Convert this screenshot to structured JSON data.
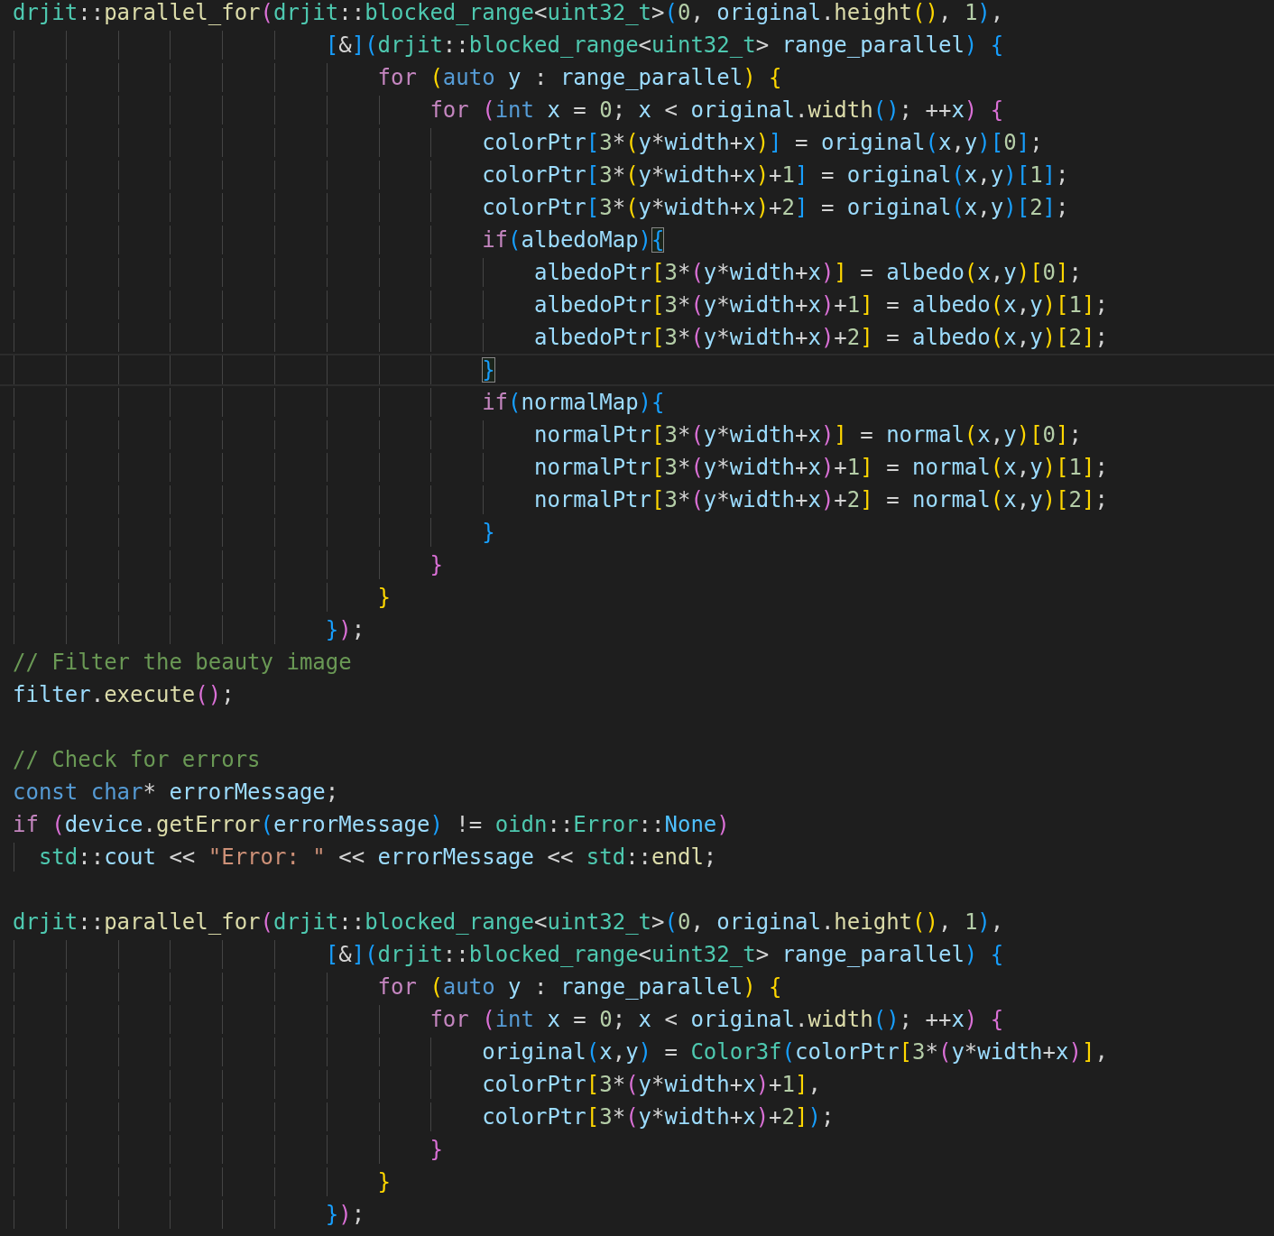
{
  "editor": {
    "lines": [
      {
        "current": false,
        "tokens": [
          {
            "kind": "ns",
            "text": "drjit"
          },
          {
            "kind": "op",
            "text": "::"
          },
          {
            "kind": "fn",
            "text": "parallel_for"
          },
          {
            "kind": "open",
            "text": "("
          },
          {
            "kind": "ns",
            "text": "drjit"
          },
          {
            "kind": "op",
            "text": "::"
          },
          {
            "kind": "ty",
            "text": "blocked_range"
          },
          {
            "kind": "op",
            "text": "<"
          },
          {
            "kind": "ty",
            "text": "uint32_t"
          },
          {
            "kind": "op",
            "text": ">"
          },
          {
            "kind": "open",
            "text": "("
          },
          {
            "kind": "num",
            "text": "0"
          },
          {
            "kind": "op",
            "text": ", "
          },
          {
            "kind": "var",
            "text": "original"
          },
          {
            "kind": "op",
            "text": "."
          },
          {
            "kind": "fn",
            "text": "height"
          },
          {
            "kind": "open",
            "text": "("
          },
          {
            "kind": "close",
            "text": ")"
          },
          {
            "kind": "op",
            "text": ", "
          },
          {
            "kind": "num",
            "text": "1"
          },
          {
            "kind": "close",
            "text": ")"
          },
          {
            "kind": "op",
            "text": ","
          }
        ]
      },
      {
        "current": false,
        "tokens": [
          {
            "kind": "open",
            "text": "                        ["
          },
          {
            "kind": "op",
            "text": "&"
          },
          {
            "kind": "close",
            "text": "]"
          },
          {
            "kind": "open",
            "text": "("
          },
          {
            "kind": "ns",
            "text": "drjit"
          },
          {
            "kind": "op",
            "text": "::"
          },
          {
            "kind": "ty",
            "text": "blocked_range"
          },
          {
            "kind": "op",
            "text": "<"
          },
          {
            "kind": "ty",
            "text": "uint32_t"
          },
          {
            "kind": "op",
            "text": "> "
          },
          {
            "kind": "var",
            "text": "range_parallel"
          },
          {
            "kind": "close",
            "text": ") "
          },
          {
            "kind": "open",
            "text": "{"
          }
        ]
      },
      {
        "current": false,
        "tokens": [
          {
            "kind": "ctl",
            "text": "                            for "
          },
          {
            "kind": "open",
            "text": "("
          },
          {
            "kind": "kw",
            "text": "auto "
          },
          {
            "kind": "var",
            "text": "y"
          },
          {
            "kind": "op",
            "text": " : "
          },
          {
            "kind": "var",
            "text": "range_parallel"
          },
          {
            "kind": "close",
            "text": ") "
          },
          {
            "kind": "open",
            "text": "{"
          }
        ]
      },
      {
        "current": false,
        "tokens": [
          {
            "kind": "ctl",
            "text": "                                for "
          },
          {
            "kind": "open",
            "text": "("
          },
          {
            "kind": "kw",
            "text": "int "
          },
          {
            "kind": "var",
            "text": "x"
          },
          {
            "kind": "op",
            "text": " = "
          },
          {
            "kind": "num",
            "text": "0"
          },
          {
            "kind": "op",
            "text": "; "
          },
          {
            "kind": "var",
            "text": "x"
          },
          {
            "kind": "op",
            "text": " < "
          },
          {
            "kind": "var",
            "text": "original"
          },
          {
            "kind": "op",
            "text": "."
          },
          {
            "kind": "fn",
            "text": "width"
          },
          {
            "kind": "open",
            "text": "("
          },
          {
            "kind": "close",
            "text": ")"
          },
          {
            "kind": "op",
            "text": "; ++"
          },
          {
            "kind": "var",
            "text": "x"
          },
          {
            "kind": "close",
            "text": ") "
          },
          {
            "kind": "open",
            "text": "{"
          }
        ]
      },
      {
        "current": false,
        "tokens": [
          {
            "kind": "var",
            "text": "                                    colorPtr"
          },
          {
            "kind": "open",
            "text": "["
          },
          {
            "kind": "num",
            "text": "3"
          },
          {
            "kind": "op",
            "text": "*"
          },
          {
            "kind": "open",
            "text": "("
          },
          {
            "kind": "var",
            "text": "y"
          },
          {
            "kind": "op",
            "text": "*"
          },
          {
            "kind": "var",
            "text": "width"
          },
          {
            "kind": "op",
            "text": "+"
          },
          {
            "kind": "var",
            "text": "x"
          },
          {
            "kind": "close",
            "text": ")"
          },
          {
            "kind": "close",
            "text": "]"
          },
          {
            "kind": "op",
            "text": " = "
          },
          {
            "kind": "var",
            "text": "original"
          },
          {
            "kind": "open",
            "text": "("
          },
          {
            "kind": "var",
            "text": "x"
          },
          {
            "kind": "op",
            "text": ","
          },
          {
            "kind": "var",
            "text": "y"
          },
          {
            "kind": "close",
            "text": ")"
          },
          {
            "kind": "open",
            "text": "["
          },
          {
            "kind": "num",
            "text": "0"
          },
          {
            "kind": "close",
            "text": "]"
          },
          {
            "kind": "op",
            "text": ";"
          }
        ]
      },
      {
        "current": false,
        "tokens": [
          {
            "kind": "var",
            "text": "                                    colorPtr"
          },
          {
            "kind": "open",
            "text": "["
          },
          {
            "kind": "num",
            "text": "3"
          },
          {
            "kind": "op",
            "text": "*"
          },
          {
            "kind": "open",
            "text": "("
          },
          {
            "kind": "var",
            "text": "y"
          },
          {
            "kind": "op",
            "text": "*"
          },
          {
            "kind": "var",
            "text": "width"
          },
          {
            "kind": "op",
            "text": "+"
          },
          {
            "kind": "var",
            "text": "x"
          },
          {
            "kind": "close",
            "text": ")"
          },
          {
            "kind": "op",
            "text": "+"
          },
          {
            "kind": "num",
            "text": "1"
          },
          {
            "kind": "close",
            "text": "]"
          },
          {
            "kind": "op",
            "text": " = "
          },
          {
            "kind": "var",
            "text": "original"
          },
          {
            "kind": "open",
            "text": "("
          },
          {
            "kind": "var",
            "text": "x"
          },
          {
            "kind": "op",
            "text": ","
          },
          {
            "kind": "var",
            "text": "y"
          },
          {
            "kind": "close",
            "text": ")"
          },
          {
            "kind": "open",
            "text": "["
          },
          {
            "kind": "num",
            "text": "1"
          },
          {
            "kind": "close",
            "text": "]"
          },
          {
            "kind": "op",
            "text": ";"
          }
        ]
      },
      {
        "current": false,
        "tokens": [
          {
            "kind": "var",
            "text": "                                    colorPtr"
          },
          {
            "kind": "open",
            "text": "["
          },
          {
            "kind": "num",
            "text": "3"
          },
          {
            "kind": "op",
            "text": "*"
          },
          {
            "kind": "open",
            "text": "("
          },
          {
            "kind": "var",
            "text": "y"
          },
          {
            "kind": "op",
            "text": "*"
          },
          {
            "kind": "var",
            "text": "width"
          },
          {
            "kind": "op",
            "text": "+"
          },
          {
            "kind": "var",
            "text": "x"
          },
          {
            "kind": "close",
            "text": ")"
          },
          {
            "kind": "op",
            "text": "+"
          },
          {
            "kind": "num",
            "text": "2"
          },
          {
            "kind": "close",
            "text": "]"
          },
          {
            "kind": "op",
            "text": " = "
          },
          {
            "kind": "var",
            "text": "original"
          },
          {
            "kind": "open",
            "text": "("
          },
          {
            "kind": "var",
            "text": "x"
          },
          {
            "kind": "op",
            "text": ","
          },
          {
            "kind": "var",
            "text": "y"
          },
          {
            "kind": "close",
            "text": ")"
          },
          {
            "kind": "open",
            "text": "["
          },
          {
            "kind": "num",
            "text": "2"
          },
          {
            "kind": "close",
            "text": "]"
          },
          {
            "kind": "op",
            "text": ";"
          }
        ]
      },
      {
        "current": false,
        "tokens": [
          {
            "kind": "ctl",
            "text": "                                    if"
          },
          {
            "kind": "open",
            "text": "("
          },
          {
            "kind": "var",
            "text": "albedoMap"
          },
          {
            "kind": "close",
            "text": ")"
          },
          {
            "kind": "open",
            "text": "{",
            "matched": true
          }
        ]
      },
      {
        "current": false,
        "tokens": [
          {
            "kind": "var",
            "text": "                                        albedoPtr"
          },
          {
            "kind": "open",
            "text": "["
          },
          {
            "kind": "num",
            "text": "3"
          },
          {
            "kind": "op",
            "text": "*"
          },
          {
            "kind": "open",
            "text": "("
          },
          {
            "kind": "var",
            "text": "y"
          },
          {
            "kind": "op",
            "text": "*"
          },
          {
            "kind": "var",
            "text": "width"
          },
          {
            "kind": "op",
            "text": "+"
          },
          {
            "kind": "var",
            "text": "x"
          },
          {
            "kind": "close",
            "text": ")"
          },
          {
            "kind": "close",
            "text": "]"
          },
          {
            "kind": "op",
            "text": " = "
          },
          {
            "kind": "var",
            "text": "albedo"
          },
          {
            "kind": "open",
            "text": "("
          },
          {
            "kind": "var",
            "text": "x"
          },
          {
            "kind": "op",
            "text": ","
          },
          {
            "kind": "var",
            "text": "y"
          },
          {
            "kind": "close",
            "text": ")"
          },
          {
            "kind": "open",
            "text": "["
          },
          {
            "kind": "num",
            "text": "0"
          },
          {
            "kind": "close",
            "text": "]"
          },
          {
            "kind": "op",
            "text": ";"
          }
        ]
      },
      {
        "current": false,
        "tokens": [
          {
            "kind": "var",
            "text": "                                        albedoPtr"
          },
          {
            "kind": "open",
            "text": "["
          },
          {
            "kind": "num",
            "text": "3"
          },
          {
            "kind": "op",
            "text": "*"
          },
          {
            "kind": "open",
            "text": "("
          },
          {
            "kind": "var",
            "text": "y"
          },
          {
            "kind": "op",
            "text": "*"
          },
          {
            "kind": "var",
            "text": "width"
          },
          {
            "kind": "op",
            "text": "+"
          },
          {
            "kind": "var",
            "text": "x"
          },
          {
            "kind": "close",
            "text": ")"
          },
          {
            "kind": "op",
            "text": "+"
          },
          {
            "kind": "num",
            "text": "1"
          },
          {
            "kind": "close",
            "text": "]"
          },
          {
            "kind": "op",
            "text": " = "
          },
          {
            "kind": "var",
            "text": "albedo"
          },
          {
            "kind": "open",
            "text": "("
          },
          {
            "kind": "var",
            "text": "x"
          },
          {
            "kind": "op",
            "text": ","
          },
          {
            "kind": "var",
            "text": "y"
          },
          {
            "kind": "close",
            "text": ")"
          },
          {
            "kind": "open",
            "text": "["
          },
          {
            "kind": "num",
            "text": "1"
          },
          {
            "kind": "close",
            "text": "]"
          },
          {
            "kind": "op",
            "text": ";"
          }
        ]
      },
      {
        "current": false,
        "tokens": [
          {
            "kind": "var",
            "text": "                                        albedoPtr"
          },
          {
            "kind": "open",
            "text": "["
          },
          {
            "kind": "num",
            "text": "3"
          },
          {
            "kind": "op",
            "text": "*"
          },
          {
            "kind": "open",
            "text": "("
          },
          {
            "kind": "var",
            "text": "y"
          },
          {
            "kind": "op",
            "text": "*"
          },
          {
            "kind": "var",
            "text": "width"
          },
          {
            "kind": "op",
            "text": "+"
          },
          {
            "kind": "var",
            "text": "x"
          },
          {
            "kind": "close",
            "text": ")"
          },
          {
            "kind": "op",
            "text": "+"
          },
          {
            "kind": "num",
            "text": "2"
          },
          {
            "kind": "close",
            "text": "]"
          },
          {
            "kind": "op",
            "text": " = "
          },
          {
            "kind": "var",
            "text": "albedo"
          },
          {
            "kind": "open",
            "text": "("
          },
          {
            "kind": "var",
            "text": "x"
          },
          {
            "kind": "op",
            "text": ","
          },
          {
            "kind": "var",
            "text": "y"
          },
          {
            "kind": "close",
            "text": ")"
          },
          {
            "kind": "open",
            "text": "["
          },
          {
            "kind": "num",
            "text": "2"
          },
          {
            "kind": "close",
            "text": "]"
          },
          {
            "kind": "op",
            "text": ";"
          }
        ]
      },
      {
        "current": true,
        "tokens": [
          {
            "kind": "close",
            "text": "                                    }",
            "matched": true
          }
        ]
      },
      {
        "current": false,
        "tokens": [
          {
            "kind": "ctl",
            "text": "                                    if"
          },
          {
            "kind": "open",
            "text": "("
          },
          {
            "kind": "var",
            "text": "normalMap"
          },
          {
            "kind": "close",
            "text": ")"
          },
          {
            "kind": "open",
            "text": "{"
          }
        ]
      },
      {
        "current": false,
        "tokens": [
          {
            "kind": "var",
            "text": "                                        normalPtr"
          },
          {
            "kind": "open",
            "text": "["
          },
          {
            "kind": "num",
            "text": "3"
          },
          {
            "kind": "op",
            "text": "*"
          },
          {
            "kind": "open",
            "text": "("
          },
          {
            "kind": "var",
            "text": "y"
          },
          {
            "kind": "op",
            "text": "*"
          },
          {
            "kind": "var",
            "text": "width"
          },
          {
            "kind": "op",
            "text": "+"
          },
          {
            "kind": "var",
            "text": "x"
          },
          {
            "kind": "close",
            "text": ")"
          },
          {
            "kind": "close",
            "text": "]"
          },
          {
            "kind": "op",
            "text": " = "
          },
          {
            "kind": "var",
            "text": "normal"
          },
          {
            "kind": "open",
            "text": "("
          },
          {
            "kind": "var",
            "text": "x"
          },
          {
            "kind": "op",
            "text": ","
          },
          {
            "kind": "var",
            "text": "y"
          },
          {
            "kind": "close",
            "text": ")"
          },
          {
            "kind": "open",
            "text": "["
          },
          {
            "kind": "num",
            "text": "0"
          },
          {
            "kind": "close",
            "text": "]"
          },
          {
            "kind": "op",
            "text": ";"
          }
        ]
      },
      {
        "current": false,
        "tokens": [
          {
            "kind": "var",
            "text": "                                        normalPtr"
          },
          {
            "kind": "open",
            "text": "["
          },
          {
            "kind": "num",
            "text": "3"
          },
          {
            "kind": "op",
            "text": "*"
          },
          {
            "kind": "open",
            "text": "("
          },
          {
            "kind": "var",
            "text": "y"
          },
          {
            "kind": "op",
            "text": "*"
          },
          {
            "kind": "var",
            "text": "width"
          },
          {
            "kind": "op",
            "text": "+"
          },
          {
            "kind": "var",
            "text": "x"
          },
          {
            "kind": "close",
            "text": ")"
          },
          {
            "kind": "op",
            "text": "+"
          },
          {
            "kind": "num",
            "text": "1"
          },
          {
            "kind": "close",
            "text": "]"
          },
          {
            "kind": "op",
            "text": " = "
          },
          {
            "kind": "var",
            "text": "normal"
          },
          {
            "kind": "open",
            "text": "("
          },
          {
            "kind": "var",
            "text": "x"
          },
          {
            "kind": "op",
            "text": ","
          },
          {
            "kind": "var",
            "text": "y"
          },
          {
            "kind": "close",
            "text": ")"
          },
          {
            "kind": "open",
            "text": "["
          },
          {
            "kind": "num",
            "text": "1"
          },
          {
            "kind": "close",
            "text": "]"
          },
          {
            "kind": "op",
            "text": ";"
          }
        ]
      },
      {
        "current": false,
        "tokens": [
          {
            "kind": "var",
            "text": "                                        normalPtr"
          },
          {
            "kind": "open",
            "text": "["
          },
          {
            "kind": "num",
            "text": "3"
          },
          {
            "kind": "op",
            "text": "*"
          },
          {
            "kind": "open",
            "text": "("
          },
          {
            "kind": "var",
            "text": "y"
          },
          {
            "kind": "op",
            "text": "*"
          },
          {
            "kind": "var",
            "text": "width"
          },
          {
            "kind": "op",
            "text": "+"
          },
          {
            "kind": "var",
            "text": "x"
          },
          {
            "kind": "close",
            "text": ")"
          },
          {
            "kind": "op",
            "text": "+"
          },
          {
            "kind": "num",
            "text": "2"
          },
          {
            "kind": "close",
            "text": "]"
          },
          {
            "kind": "op",
            "text": " = "
          },
          {
            "kind": "var",
            "text": "normal"
          },
          {
            "kind": "open",
            "text": "("
          },
          {
            "kind": "var",
            "text": "x"
          },
          {
            "kind": "op",
            "text": ","
          },
          {
            "kind": "var",
            "text": "y"
          },
          {
            "kind": "close",
            "text": ")"
          },
          {
            "kind": "open",
            "text": "["
          },
          {
            "kind": "num",
            "text": "2"
          },
          {
            "kind": "close",
            "text": "]"
          },
          {
            "kind": "op",
            "text": ";"
          }
        ]
      },
      {
        "current": false,
        "tokens": [
          {
            "kind": "close",
            "text": "                                    }"
          }
        ]
      },
      {
        "current": false,
        "tokens": [
          {
            "kind": "close",
            "text": "                                }"
          }
        ]
      },
      {
        "current": false,
        "tokens": [
          {
            "kind": "close",
            "text": "                            }"
          }
        ]
      },
      {
        "current": false,
        "tokens": [
          {
            "kind": "close",
            "text": "                        }"
          },
          {
            "kind": "close",
            "text": ")"
          },
          {
            "kind": "op",
            "text": ";"
          }
        ]
      },
      {
        "current": false,
        "tokens": [
          {
            "kind": "cmt",
            "text": "// Filter the beauty image"
          }
        ]
      },
      {
        "current": false,
        "tokens": [
          {
            "kind": "var",
            "text": "filter"
          },
          {
            "kind": "op",
            "text": "."
          },
          {
            "kind": "fn",
            "text": "execute"
          },
          {
            "kind": "open",
            "text": "("
          },
          {
            "kind": "close",
            "text": ")"
          },
          {
            "kind": "op",
            "text": ";"
          }
        ]
      },
      {
        "current": false
      },
      {
        "current": false,
        "tokens": [
          {
            "kind": "cmt",
            "text": "// Check for errors"
          }
        ]
      },
      {
        "current": false,
        "tokens": [
          {
            "kind": "kw",
            "text": "const "
          },
          {
            "kind": "kw",
            "text": "char"
          },
          {
            "kind": "op",
            "text": "* "
          },
          {
            "kind": "var",
            "text": "errorMessage"
          },
          {
            "kind": "op",
            "text": ";"
          }
        ]
      },
      {
        "current": false,
        "tokens": [
          {
            "kind": "ctl",
            "text": "if "
          },
          {
            "kind": "open",
            "text": "("
          },
          {
            "kind": "var",
            "text": "device"
          },
          {
            "kind": "op",
            "text": "."
          },
          {
            "kind": "fn",
            "text": "getError"
          },
          {
            "kind": "open",
            "text": "("
          },
          {
            "kind": "var",
            "text": "errorMessage"
          },
          {
            "kind": "close",
            "text": ")"
          },
          {
            "kind": "op",
            "text": " != "
          },
          {
            "kind": "ns",
            "text": "oidn"
          },
          {
            "kind": "op",
            "text": "::"
          },
          {
            "kind": "ty",
            "text": "Error"
          },
          {
            "kind": "op",
            "text": "::"
          },
          {
            "kind": "cst",
            "text": "None"
          },
          {
            "kind": "close",
            "text": ")"
          }
        ]
      },
      {
        "current": false,
        "tokens": [
          {
            "kind": "ns",
            "text": "  std"
          },
          {
            "kind": "op",
            "text": "::"
          },
          {
            "kind": "var",
            "text": "cout"
          },
          {
            "kind": "op",
            "text": " << "
          },
          {
            "kind": "str",
            "text": "\"Error: \""
          },
          {
            "kind": "op",
            "text": " << "
          },
          {
            "kind": "var",
            "text": "errorMessage"
          },
          {
            "kind": "op",
            "text": " << "
          },
          {
            "kind": "ns",
            "text": "std"
          },
          {
            "kind": "op",
            "text": "::"
          },
          {
            "kind": "fn",
            "text": "endl"
          },
          {
            "kind": "op",
            "text": ";"
          }
        ]
      },
      {
        "current": false
      },
      {
        "current": false,
        "tokens": [
          {
            "kind": "ns",
            "text": "drjit"
          },
          {
            "kind": "op",
            "text": "::"
          },
          {
            "kind": "fn",
            "text": "parallel_for"
          },
          {
            "kind": "open",
            "text": "("
          },
          {
            "kind": "ns",
            "text": "drjit"
          },
          {
            "kind": "op",
            "text": "::"
          },
          {
            "kind": "ty",
            "text": "blocked_range"
          },
          {
            "kind": "op",
            "text": "<"
          },
          {
            "kind": "ty",
            "text": "uint32_t"
          },
          {
            "kind": "op",
            "text": ">"
          },
          {
            "kind": "open",
            "text": "("
          },
          {
            "kind": "num",
            "text": "0"
          },
          {
            "kind": "op",
            "text": ", "
          },
          {
            "kind": "var",
            "text": "original"
          },
          {
            "kind": "op",
            "text": "."
          },
          {
            "kind": "fn",
            "text": "height"
          },
          {
            "kind": "open",
            "text": "("
          },
          {
            "kind": "close",
            "text": ")"
          },
          {
            "kind": "op",
            "text": ", "
          },
          {
            "kind": "num",
            "text": "1"
          },
          {
            "kind": "close",
            "text": ")"
          },
          {
            "kind": "op",
            "text": ","
          }
        ]
      },
      {
        "current": false,
        "tokens": [
          {
            "kind": "open",
            "text": "                        ["
          },
          {
            "kind": "op",
            "text": "&"
          },
          {
            "kind": "close",
            "text": "]"
          },
          {
            "kind": "open",
            "text": "("
          },
          {
            "kind": "ns",
            "text": "drjit"
          },
          {
            "kind": "op",
            "text": "::"
          },
          {
            "kind": "ty",
            "text": "blocked_range"
          },
          {
            "kind": "op",
            "text": "<"
          },
          {
            "kind": "ty",
            "text": "uint32_t"
          },
          {
            "kind": "op",
            "text": "> "
          },
          {
            "kind": "var",
            "text": "range_parallel"
          },
          {
            "kind": "close",
            "text": ") "
          },
          {
            "kind": "open",
            "text": "{"
          }
        ]
      },
      {
        "current": false,
        "tokens": [
          {
            "kind": "ctl",
            "text": "                            for "
          },
          {
            "kind": "open",
            "text": "("
          },
          {
            "kind": "kw",
            "text": "auto "
          },
          {
            "kind": "var",
            "text": "y"
          },
          {
            "kind": "op",
            "text": " : "
          },
          {
            "kind": "var",
            "text": "range_parallel"
          },
          {
            "kind": "close",
            "text": ") "
          },
          {
            "kind": "open",
            "text": "{"
          }
        ]
      },
      {
        "current": false,
        "tokens": [
          {
            "kind": "ctl",
            "text": "                                for "
          },
          {
            "kind": "open",
            "text": "("
          },
          {
            "kind": "kw",
            "text": "int "
          },
          {
            "kind": "var",
            "text": "x"
          },
          {
            "kind": "op",
            "text": " = "
          },
          {
            "kind": "num",
            "text": "0"
          },
          {
            "kind": "op",
            "text": "; "
          },
          {
            "kind": "var",
            "text": "x"
          },
          {
            "kind": "op",
            "text": " < "
          },
          {
            "kind": "var",
            "text": "original"
          },
          {
            "kind": "op",
            "text": "."
          },
          {
            "kind": "fn",
            "text": "width"
          },
          {
            "kind": "open",
            "text": "("
          },
          {
            "kind": "close",
            "text": ")"
          },
          {
            "kind": "op",
            "text": "; ++"
          },
          {
            "kind": "var",
            "text": "x"
          },
          {
            "kind": "close",
            "text": ") "
          },
          {
            "kind": "open",
            "text": "{"
          }
        ]
      },
      {
        "current": false,
        "tokens": [
          {
            "kind": "var",
            "text": "                                    original"
          },
          {
            "kind": "open",
            "text": "("
          },
          {
            "kind": "var",
            "text": "x"
          },
          {
            "kind": "op",
            "text": ","
          },
          {
            "kind": "var",
            "text": "y"
          },
          {
            "kind": "close",
            "text": ")"
          },
          {
            "kind": "op",
            "text": " = "
          },
          {
            "kind": "ty",
            "text": "Color3f"
          },
          {
            "kind": "open",
            "text": "("
          },
          {
            "kind": "var",
            "text": "colorPtr"
          },
          {
            "kind": "open",
            "text": "["
          },
          {
            "kind": "num",
            "text": "3"
          },
          {
            "kind": "op",
            "text": "*"
          },
          {
            "kind": "open",
            "text": "("
          },
          {
            "kind": "var",
            "text": "y"
          },
          {
            "kind": "op",
            "text": "*"
          },
          {
            "kind": "var",
            "text": "width"
          },
          {
            "kind": "op",
            "text": "+"
          },
          {
            "kind": "var",
            "text": "x"
          },
          {
            "kind": "close",
            "text": ")"
          },
          {
            "kind": "close",
            "text": "]"
          },
          {
            "kind": "op",
            "text": ","
          }
        ]
      },
      {
        "current": false,
        "tokens": [
          {
            "kind": "var",
            "text": "                                    colorPtr"
          },
          {
            "kind": "open",
            "text": "["
          },
          {
            "kind": "num",
            "text": "3"
          },
          {
            "kind": "op",
            "text": "*"
          },
          {
            "kind": "open",
            "text": "("
          },
          {
            "kind": "var",
            "text": "y"
          },
          {
            "kind": "op",
            "text": "*"
          },
          {
            "kind": "var",
            "text": "width"
          },
          {
            "kind": "op",
            "text": "+"
          },
          {
            "kind": "var",
            "text": "x"
          },
          {
            "kind": "close",
            "text": ")"
          },
          {
            "kind": "op",
            "text": "+"
          },
          {
            "kind": "num",
            "text": "1"
          },
          {
            "kind": "close",
            "text": "]"
          },
          {
            "kind": "op",
            "text": ","
          }
        ]
      },
      {
        "current": false,
        "tokens": [
          {
            "kind": "var",
            "text": "                                    colorPtr"
          },
          {
            "kind": "open",
            "text": "["
          },
          {
            "kind": "num",
            "text": "3"
          },
          {
            "kind": "op",
            "text": "*"
          },
          {
            "kind": "open",
            "text": "("
          },
          {
            "kind": "var",
            "text": "y"
          },
          {
            "kind": "op",
            "text": "*"
          },
          {
            "kind": "var",
            "text": "width"
          },
          {
            "kind": "op",
            "text": "+"
          },
          {
            "kind": "var",
            "text": "x"
          },
          {
            "kind": "close",
            "text": ")"
          },
          {
            "kind": "op",
            "text": "+"
          },
          {
            "kind": "num",
            "text": "2"
          },
          {
            "kind": "close",
            "text": "]"
          },
          {
            "kind": "close",
            "text": ")"
          },
          {
            "kind": "op",
            "text": ";"
          }
        ]
      },
      {
        "current": false,
        "tokens": [
          {
            "kind": "close",
            "text": "                                }"
          }
        ]
      },
      {
        "current": false,
        "tokens": [
          {
            "kind": "close",
            "text": "                            }"
          }
        ]
      },
      {
        "current": false,
        "tokens": [
          {
            "kind": "close",
            "text": "                        }"
          },
          {
            "kind": "close",
            "text": ")"
          },
          {
            "kind": "op",
            "text": ";"
          }
        ]
      }
    ]
  }
}
